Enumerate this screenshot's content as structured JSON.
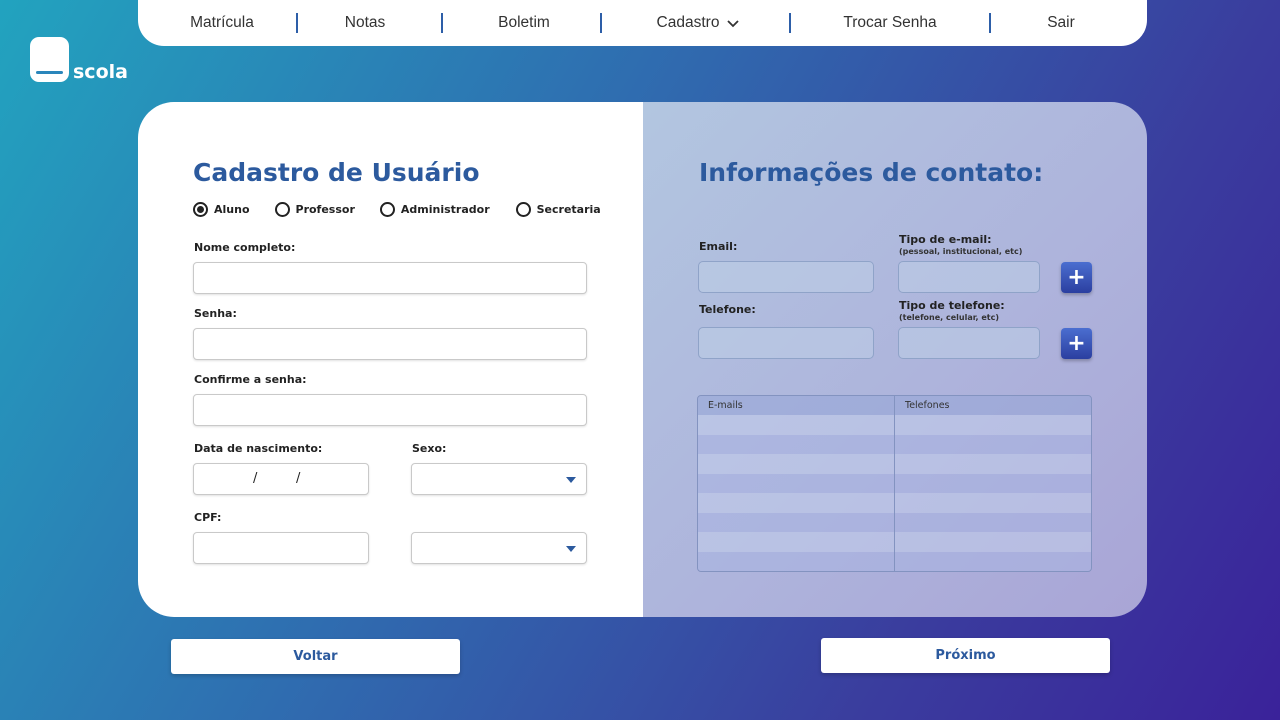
{
  "nav": {
    "items": [
      {
        "label": "Matrícula"
      },
      {
        "label": "Notas"
      },
      {
        "label": "Boletim"
      },
      {
        "label": "Cadastro"
      },
      {
        "label": "Trocar Senha"
      },
      {
        "label": "Sair"
      }
    ]
  },
  "logo": {
    "text": "scola"
  },
  "form": {
    "title": "Cadastro de Usuário",
    "roles": [
      {
        "label": "Aluno",
        "selected": true
      },
      {
        "label": "Professor",
        "selected": false
      },
      {
        "label": "Administrador",
        "selected": false
      },
      {
        "label": "Secretaria",
        "selected": false
      }
    ],
    "name_label": "Nome completo:",
    "password_label": "Senha:",
    "confirm_label": "Confirme a senha:",
    "birthdate_label": "Data de nascimento:",
    "sex_label": "Sexo:",
    "cpf_label": "CPF:",
    "date_separator": "/"
  },
  "contact": {
    "title": "Informações de contato:",
    "email_label": "Email:",
    "email_type_label": "Tipo de e-mail:",
    "email_type_hint": "(pessoal, institucional, etc)",
    "phone_label": "Telefone:",
    "phone_type_label": "Tipo de telefone:",
    "phone_type_hint": "(telefone, celular, etc)",
    "add_symbol": "+",
    "table_headers": [
      "E-mails",
      "Telefones"
    ]
  },
  "actions": {
    "back_label": "Voltar",
    "next_label": "Próximo"
  },
  "colors": {
    "accent": "#2c5a9e",
    "button_blue": "#2b3fa0"
  }
}
